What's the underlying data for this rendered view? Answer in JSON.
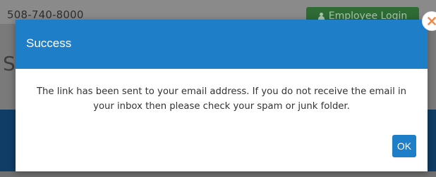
{
  "background": {
    "phone": "508-740-8000",
    "login_button_label": "Employee Login",
    "login_icon": "user-icon",
    "partial_heading_letter": "S"
  },
  "modal": {
    "title": "Success",
    "message": "The link has been sent to your email address. If you do not receive the email in your inbox then please check your spam or junk folder.",
    "ok_label": "OK",
    "close_icon": "close-icon"
  },
  "colors": {
    "header_blue": "#1e7ec8",
    "ok_blue": "#1e7ec8",
    "close_orange": "#f08a4b",
    "login_green": "#2f6b35"
  }
}
